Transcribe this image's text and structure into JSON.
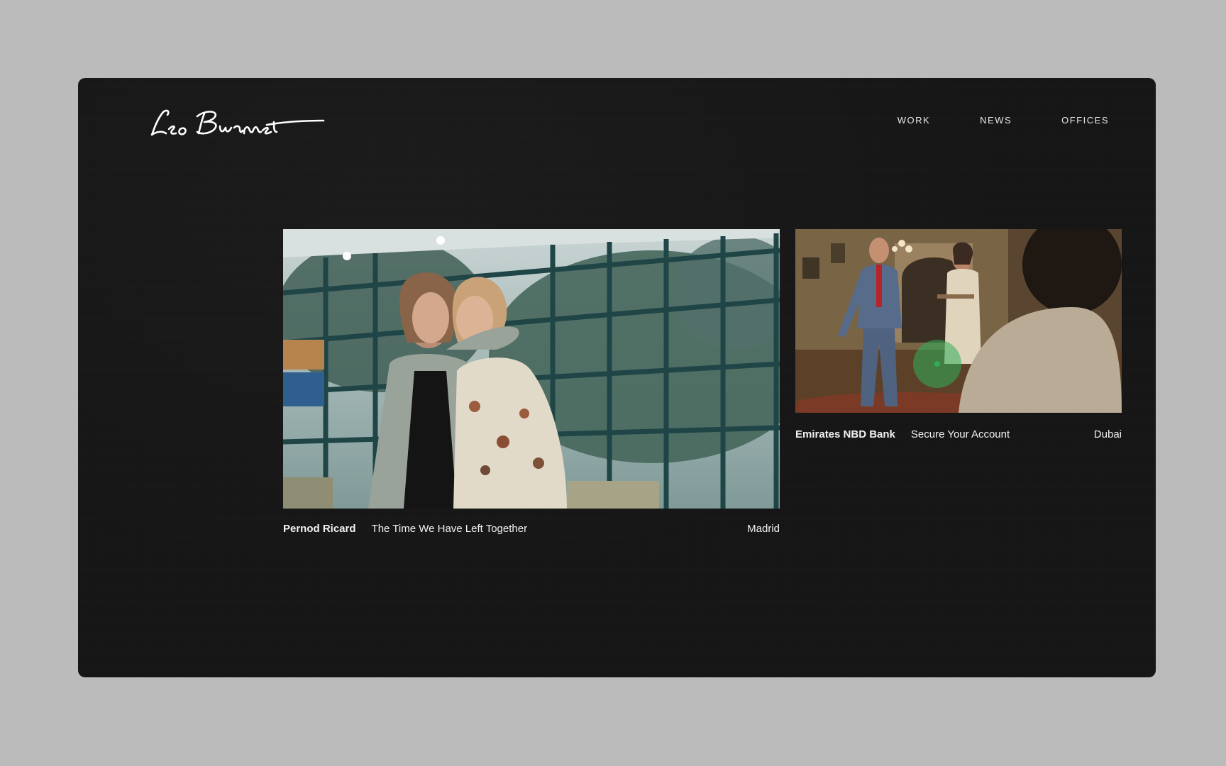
{
  "brand": {
    "name": "Leo Burnett"
  },
  "nav": {
    "items": [
      {
        "label": "WORK"
      },
      {
        "label": "NEWS"
      },
      {
        "label": "OFFICES"
      }
    ]
  },
  "work": [
    {
      "client": "Pernod Ricard",
      "title": "The Time We Have Left Together",
      "office": "Madrid",
      "thumbnail": "two-women-hugging-by-window"
    },
    {
      "client": "Emirates NBD Bank",
      "title": "Secure Your Account",
      "office": "Dubai",
      "thumbnail": "man-in-suit-in-living-room"
    }
  ],
  "colors": {
    "page_background": "#bbbbbb",
    "window_background": "#161616",
    "text": "#f2f2f2",
    "cursor_highlight": "#2fae5a"
  }
}
